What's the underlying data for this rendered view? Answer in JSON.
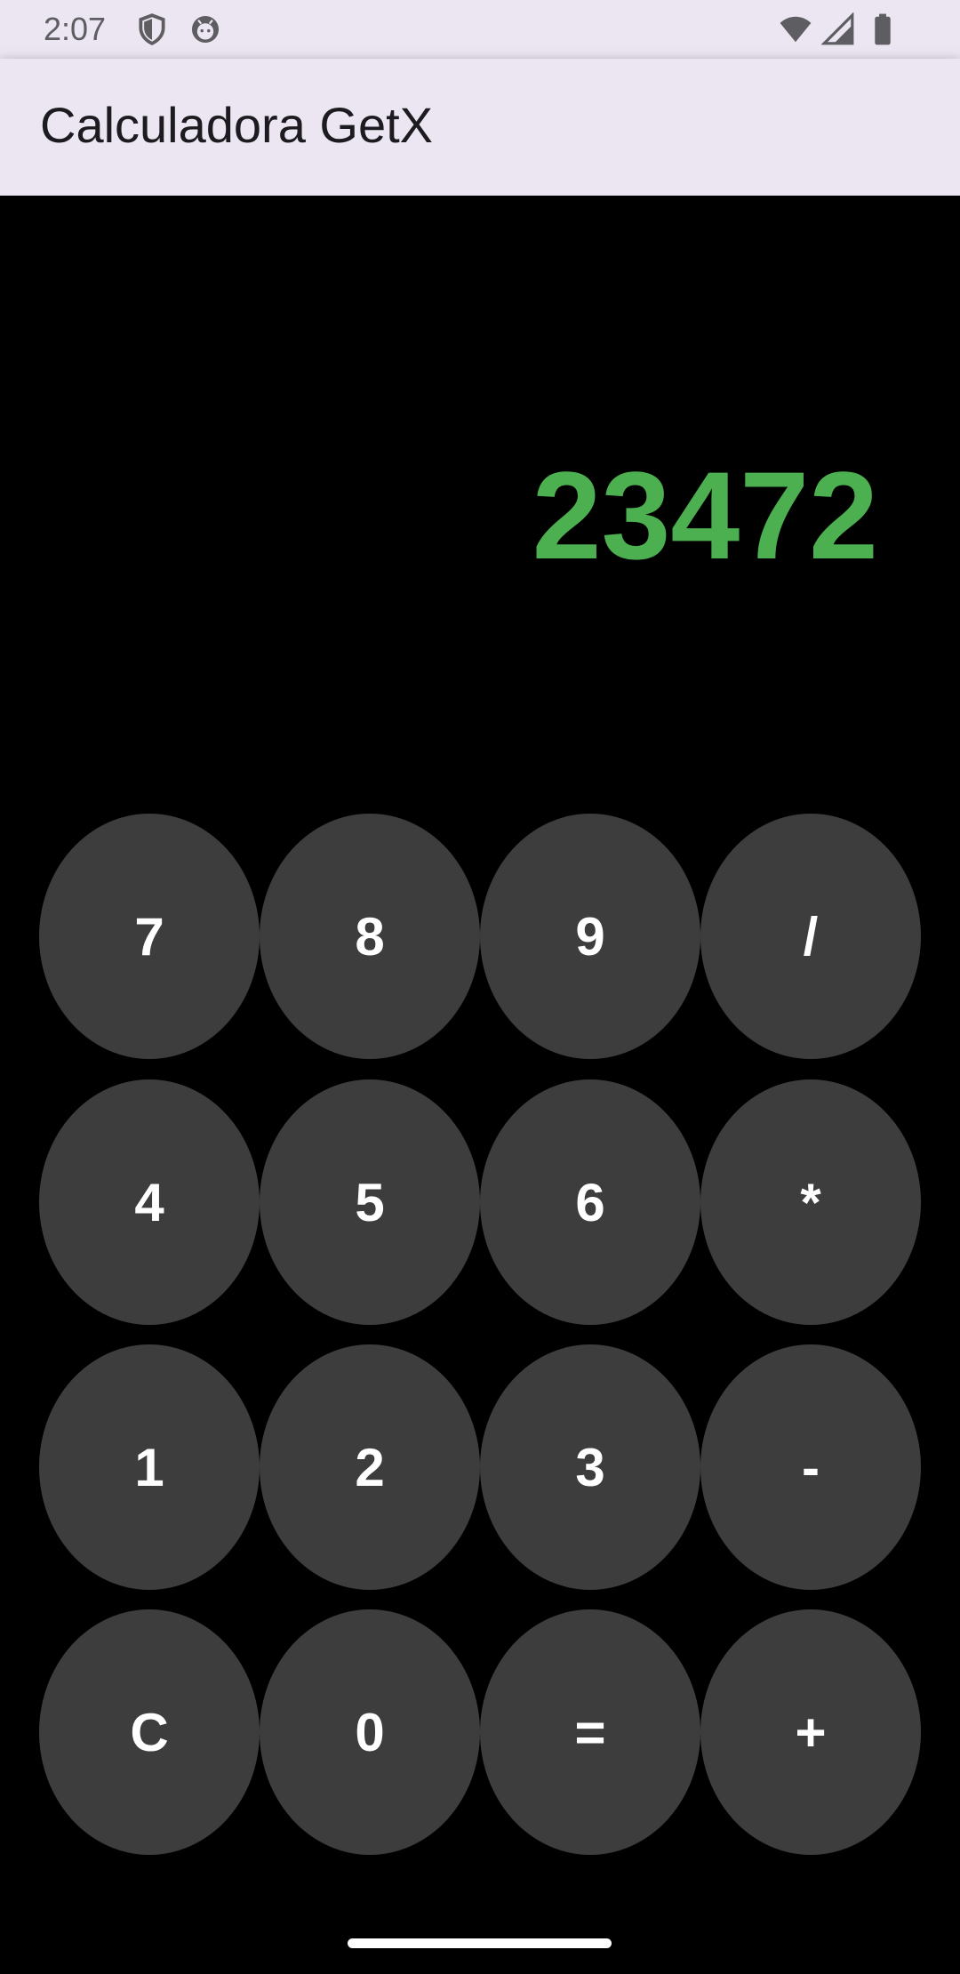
{
  "status_bar": {
    "time": "2:07",
    "icons": [
      "shield-icon",
      "android-robot-icon",
      "wifi-icon",
      "cellular-signal-icon",
      "battery-icon"
    ]
  },
  "app_bar": {
    "title": "Calculadora GetX"
  },
  "display": {
    "value": "23472"
  },
  "keypad": {
    "rows": [
      [
        "7",
        "8",
        "9",
        "/"
      ],
      [
        "4",
        "5",
        "6",
        "*"
      ],
      [
        "1",
        "2",
        "3",
        "-"
      ],
      [
        "C",
        "0",
        "=",
        "+"
      ]
    ]
  },
  "colors": {
    "background": "#000000",
    "app_bar": "#ECE5F2",
    "display_text": "#4CAF50",
    "key_background": "#3D3D3D",
    "key_text": "#FFFFFF"
  }
}
